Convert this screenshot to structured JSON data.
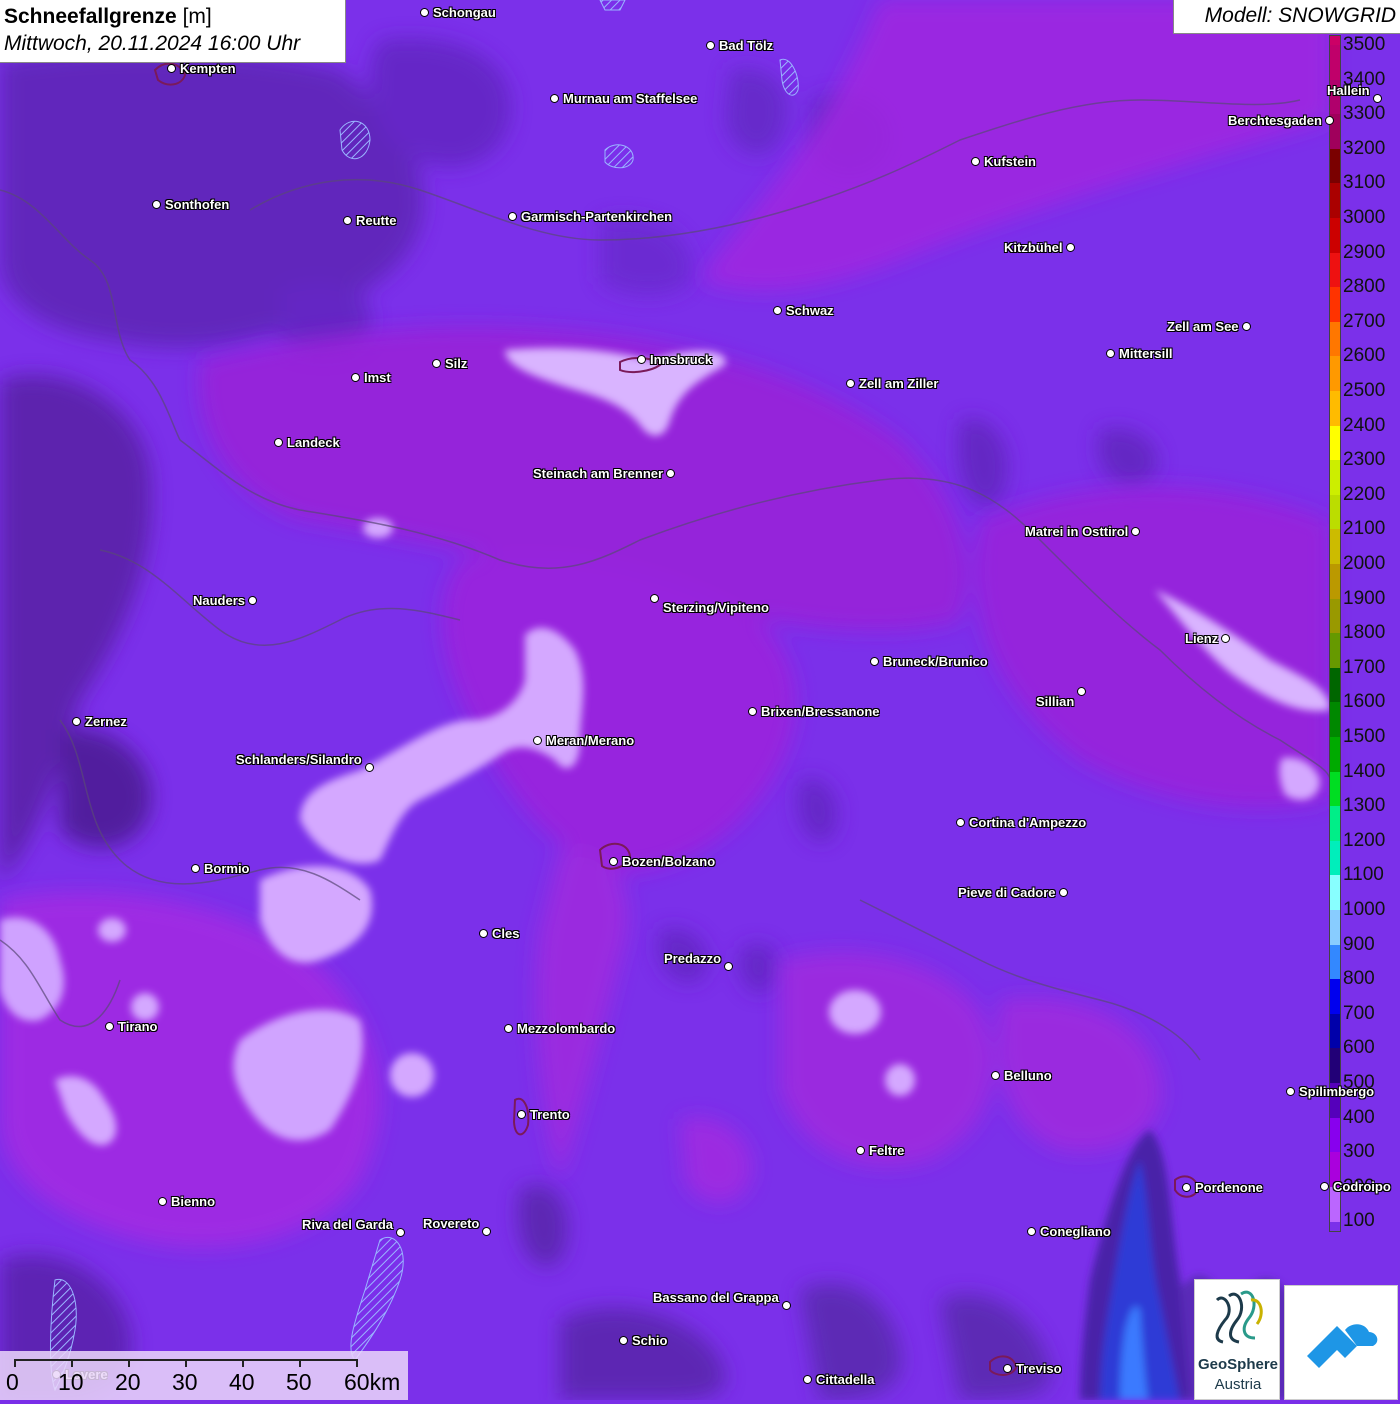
{
  "header": {
    "title_bold": "Schneefallgrenze",
    "title_unit": "[m]",
    "subtitle": "Mittwoch, 20.11.2024 16:00 Uhr",
    "model": "Modell: SNOWGRID"
  },
  "legend": {
    "unit": "m",
    "entries": [
      {
        "label": "3500",
        "color": "#cc0066"
      },
      {
        "label": "3400",
        "color": "#c0006a"
      },
      {
        "label": "3300",
        "color": "#b0006c"
      },
      {
        "label": "3200",
        "color": "#a0005c"
      },
      {
        "label": "3100",
        "color": "#7a0000"
      },
      {
        "label": "3000",
        "color": "#aa0000"
      },
      {
        "label": "2900",
        "color": "#cc0000"
      },
      {
        "label": "2800",
        "color": "#ee1111"
      },
      {
        "label": "2700",
        "color": "#ff3300"
      },
      {
        "label": "2600",
        "color": "#ff7700"
      },
      {
        "label": "2500",
        "color": "#ff9900"
      },
      {
        "label": "2400",
        "color": "#ffbb00"
      },
      {
        "label": "2300",
        "color": "#ffff00"
      },
      {
        "label": "2200",
        "color": "#ccee00"
      },
      {
        "label": "2100",
        "color": "#bbdd00"
      },
      {
        "label": "2000",
        "color": "#ccbb00"
      },
      {
        "label": "1900",
        "color": "#bb9900"
      },
      {
        "label": "1800",
        "color": "#999900"
      },
      {
        "label": "1700",
        "color": "#669900"
      },
      {
        "label": "1600",
        "color": "#006600"
      },
      {
        "label": "1500",
        "color": "#008800"
      },
      {
        "label": "1400",
        "color": "#00aa00"
      },
      {
        "label": "1300",
        "color": "#00dd22"
      },
      {
        "label": "1200",
        "color": "#00ee88"
      },
      {
        "label": "1100",
        "color": "#00eebb"
      },
      {
        "label": "1000",
        "color": "#88ffff"
      },
      {
        "label": "900",
        "color": "#88ccff"
      },
      {
        "label": "800",
        "color": "#3388ff"
      },
      {
        "label": "700",
        "color": "#0000ee"
      },
      {
        "label": "600",
        "color": "#0000aa"
      },
      {
        "label": "500",
        "color": "#220077"
      },
      {
        "label": "400",
        "color": "#5500bb"
      },
      {
        "label": "300",
        "color": "#8800ee"
      },
      {
        "label": "200",
        "color": "#aa00dd"
      },
      {
        "label": "100",
        "color": "#bb66ff"
      }
    ]
  },
  "cities": [
    {
      "name": "Schongau"
    },
    {
      "name": "Kempten"
    },
    {
      "name": "Bad Tölz"
    },
    {
      "name": "Murnau am Staffelsee"
    },
    {
      "name": "Hallein"
    },
    {
      "name": "Berchtesgaden"
    },
    {
      "name": "Kufstein"
    },
    {
      "name": "Sonthofen"
    },
    {
      "name": "Reutte"
    },
    {
      "name": "Garmisch-Partenkirchen"
    },
    {
      "name": "Kitzbühel"
    },
    {
      "name": "Schwaz"
    },
    {
      "name": "Zell am See"
    },
    {
      "name": "Innsbruck"
    },
    {
      "name": "Mittersill"
    },
    {
      "name": "Imst"
    },
    {
      "name": "Silz"
    },
    {
      "name": "Zell am Ziller"
    },
    {
      "name": "Landeck"
    },
    {
      "name": "Steinach am Brenner"
    },
    {
      "name": "Matrei in Osttirol"
    },
    {
      "name": "Nauders"
    },
    {
      "name": "Sterzing/Vipiteno"
    },
    {
      "name": "Lienz"
    },
    {
      "name": "Bruneck/Brunico"
    },
    {
      "name": "Sillian"
    },
    {
      "name": "Zernez"
    },
    {
      "name": "Brixen/Bressanone"
    },
    {
      "name": "Meran/Merano"
    },
    {
      "name": "Schlanders/Silandro"
    },
    {
      "name": "Cortina d'Ampezzo"
    },
    {
      "name": "Bormio"
    },
    {
      "name": "Bozen/Bolzano"
    },
    {
      "name": "Pieve di Cadore"
    },
    {
      "name": "Cles"
    },
    {
      "name": "Predazzo"
    },
    {
      "name": "Tirano"
    },
    {
      "name": "Mezzolombardo"
    },
    {
      "name": "Belluno"
    },
    {
      "name": "Spilimbergo"
    },
    {
      "name": "Trento"
    },
    {
      "name": "Feltre"
    },
    {
      "name": "Pordenone"
    },
    {
      "name": "Codroipo"
    },
    {
      "name": "Bienno"
    },
    {
      "name": "Riva del Garda"
    },
    {
      "name": "Rovereto"
    },
    {
      "name": "Conegliano"
    },
    {
      "name": "Bassano del Grappa"
    },
    {
      "name": "Schio"
    },
    {
      "name": "Treviso"
    },
    {
      "name": "Cittadella"
    },
    {
      "name": "Lovere"
    }
  ],
  "scale_bar": {
    "labels": [
      "0",
      "10",
      "20",
      "30",
      "40",
      "50",
      "60km"
    ]
  },
  "logos": {
    "geosphere_line1": "GeoSphere",
    "geosphere_line2": "Austria"
  }
}
